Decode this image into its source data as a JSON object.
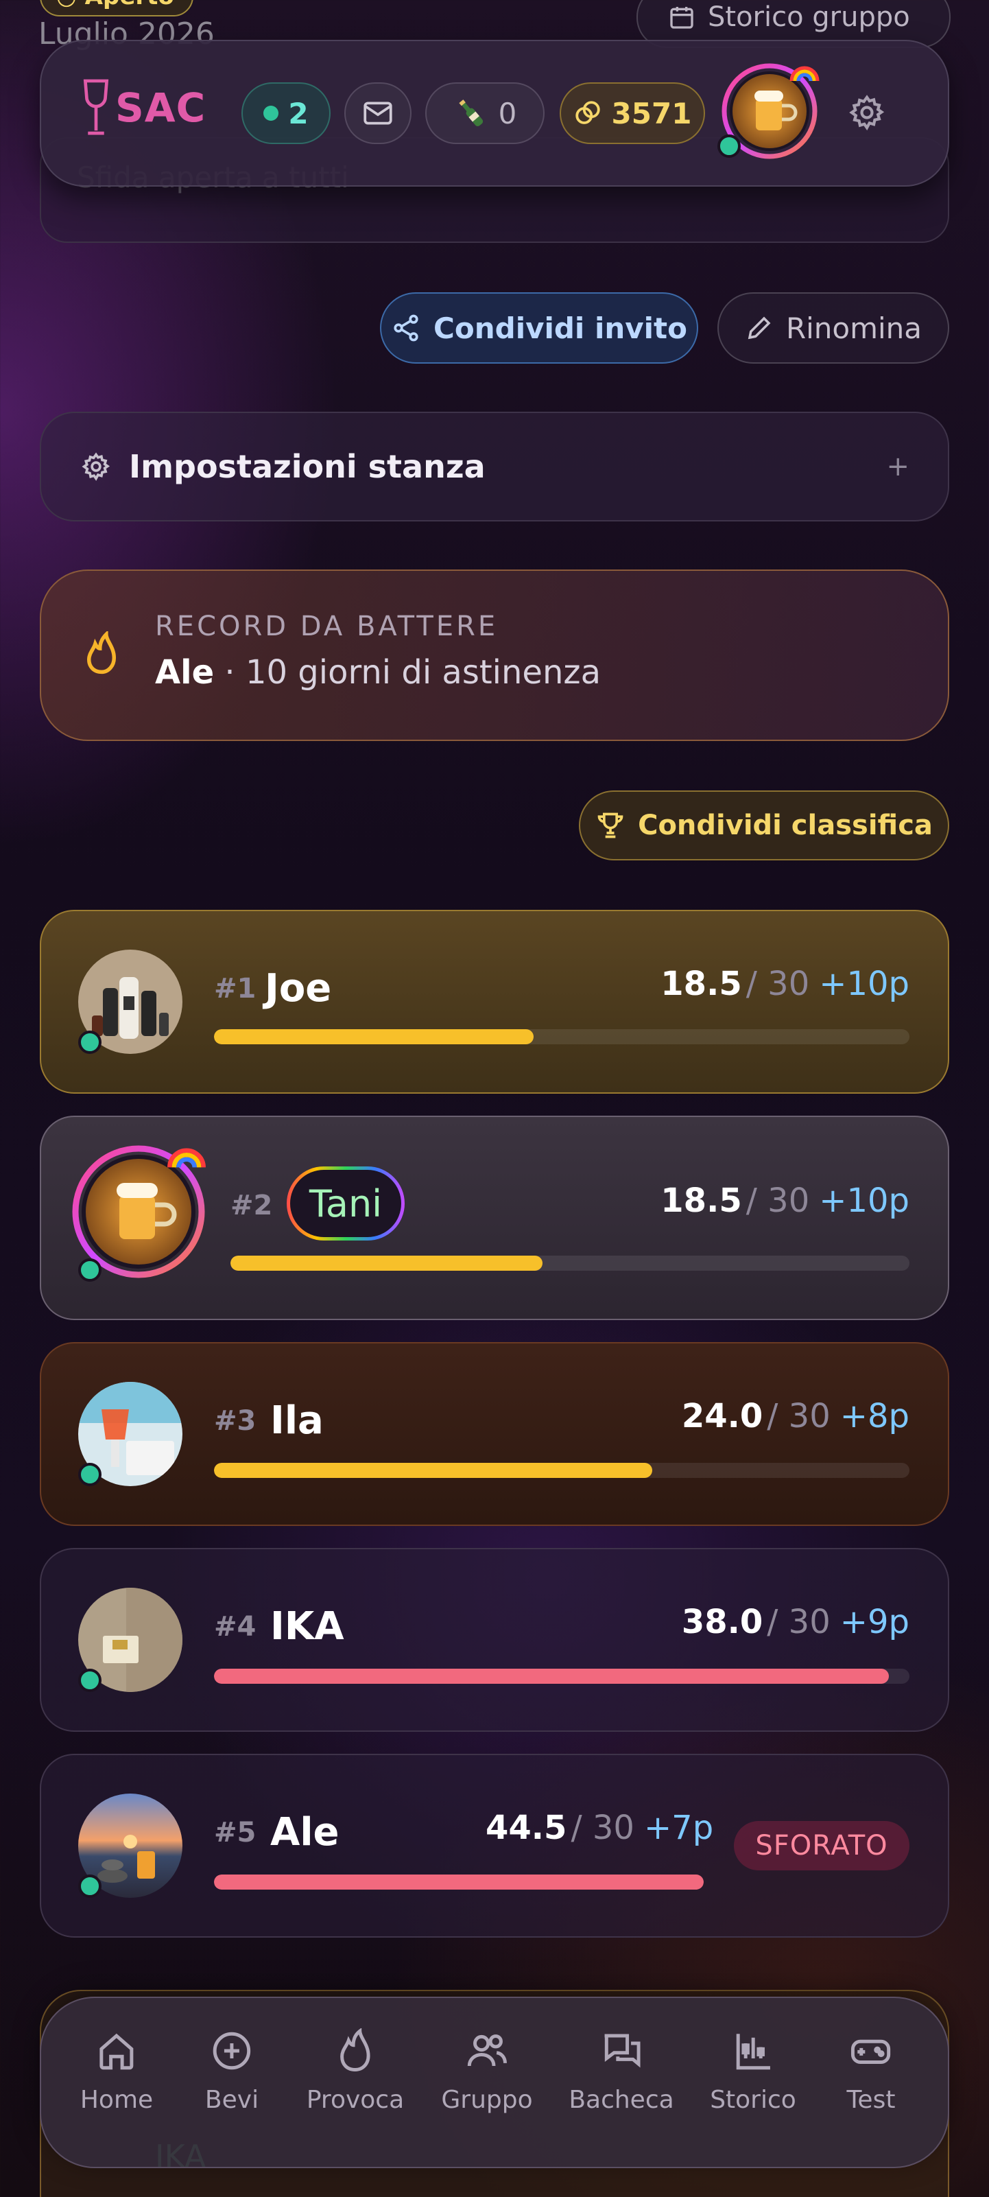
{
  "underlay": {
    "badge_label": "Aperto",
    "month_label": "Luglio 2026",
    "history_button": "Storico gruppo",
    "card_text": "Sfida aperta a tutti",
    "bottom_card_name": "IKA"
  },
  "topbar": {
    "logo": "SAC",
    "online_count": "2",
    "bottles_count": "0",
    "coins": "3571"
  },
  "actions": {
    "share_invite": "Condividi invito",
    "rename": "Rinomina"
  },
  "settings": {
    "title": "Impostazioni stanza",
    "expand_symbol": "+"
  },
  "record": {
    "label": "RECORD DA BATTERE",
    "holder": "Ale",
    "detail": "· 10 giorni di astinenza"
  },
  "leaderboard": {
    "share_button": "Condividi classifica",
    "rows": [
      {
        "rank": "#1",
        "name": "Joe",
        "score": "18.5",
        "max": "/ 30",
        "points": "+10p",
        "progress": 0.46,
        "bar_color": "#f7c02a"
      },
      {
        "rank": "#2",
        "name": "Tani",
        "score": "18.5",
        "max": "/ 30",
        "points": "+10p",
        "progress": 0.46,
        "bar_color": "#f7c02a"
      },
      {
        "rank": "#3",
        "name": "Ila",
        "score": "24.0",
        "max": "/ 30",
        "points": "+8p",
        "progress": 0.63,
        "bar_color": "#f7c02a"
      },
      {
        "rank": "#4",
        "name": "IKA",
        "score": "38.0",
        "max": "/ 30",
        "points": "+9p",
        "progress": 0.97,
        "bar_color": "#f2697e"
      },
      {
        "rank": "#5",
        "name": "Ale",
        "score": "44.5",
        "max": "/ 30",
        "points": "+7p",
        "progress": 1.0,
        "bar_color": "#f2697e",
        "status": "SFORATO"
      }
    ]
  },
  "nav": {
    "items": [
      "Home",
      "Bevi",
      "Provoca",
      "Gruppo",
      "Bacheca",
      "Storico",
      "Test"
    ]
  },
  "colors": {
    "accent_pink": "#e05aa8",
    "gold": "#f6d76a",
    "online_green": "#2fc59a",
    "bar_yellow": "#f7c02a",
    "bar_red": "#f2697e",
    "points_blue": "#7ec8ff"
  }
}
